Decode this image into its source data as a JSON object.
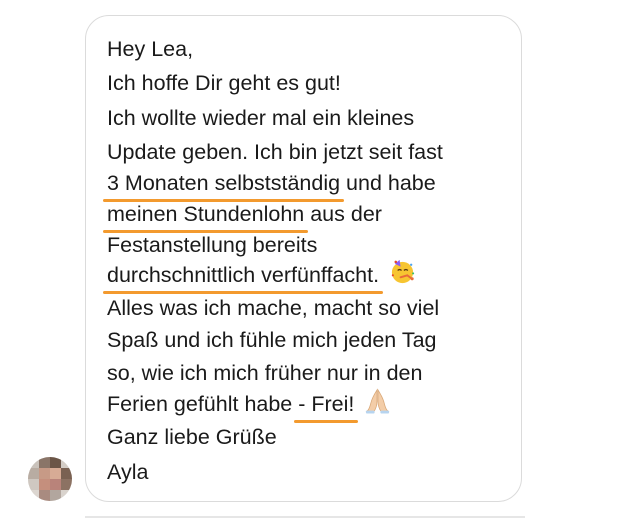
{
  "colors": {
    "highlight": "#f39a2e",
    "bubble_border": "#dbdbdb",
    "text": "#1a1a1a"
  },
  "message": {
    "line1": "Hey Lea,",
    "line2": "Ich hoffe Dir geht es gut!",
    "line3": "Ich wollte wieder mal ein kleines",
    "line4": "Update geben. Ich bin jetzt seit fast",
    "line5_hl": "3 Monaten selbstständig",
    "line5_rest": " und habe",
    "line6_hl": "meinen Stundenlohn",
    "line6_rest": " aus der",
    "line7": "Festanstellung bereits",
    "line8_hl": "durchschnittlich verfünffacht.",
    "line9": "Alles was ich mache, macht so viel",
    "line10": "Spaß und ich fühle mich jeden Tag",
    "line11": "so, wie ich mich früher nur in den",
    "line12_start": "Ferien gefühlt habe ",
    "line12_hl": "- Frei!",
    "line13": "Ganz liebe Grüße",
    "line14": "Ayla"
  },
  "icons": {
    "party": "party-face-emoji",
    "pray": "folded-hands-emoji",
    "avatar": "pixelated-avatar"
  }
}
